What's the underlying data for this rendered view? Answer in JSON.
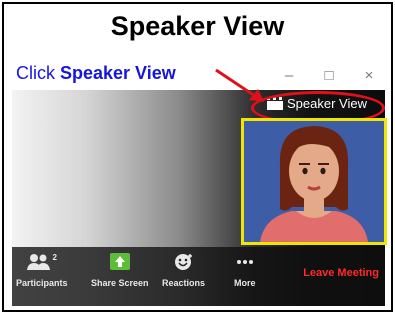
{
  "heading": "Speaker View",
  "instruction": {
    "lead": "Click ",
    "target": "Speaker View"
  },
  "window_controls": {
    "minimize": "–",
    "maximize": "□",
    "close": "×"
  },
  "speaker_view_button": {
    "label": "Speaker View",
    "icon": "grid-icon"
  },
  "video_tile": {
    "participant": "female-avatar"
  },
  "toolbar": {
    "participants": {
      "label": "Participants",
      "count": "2",
      "icon": "participants-icon"
    },
    "share_screen": {
      "label": "Share Screen",
      "icon": "share-screen-icon"
    },
    "reactions": {
      "label": "Reactions",
      "icon": "reactions-icon"
    },
    "more": {
      "label": "More",
      "icon": "more-icon"
    },
    "leave": {
      "label": "Leave Meeting"
    }
  },
  "colors": {
    "instruction_text": "#1515e0",
    "highlight": "#e0101a",
    "tile_border": "#f1e600",
    "leave_text": "#ff2a2a"
  }
}
